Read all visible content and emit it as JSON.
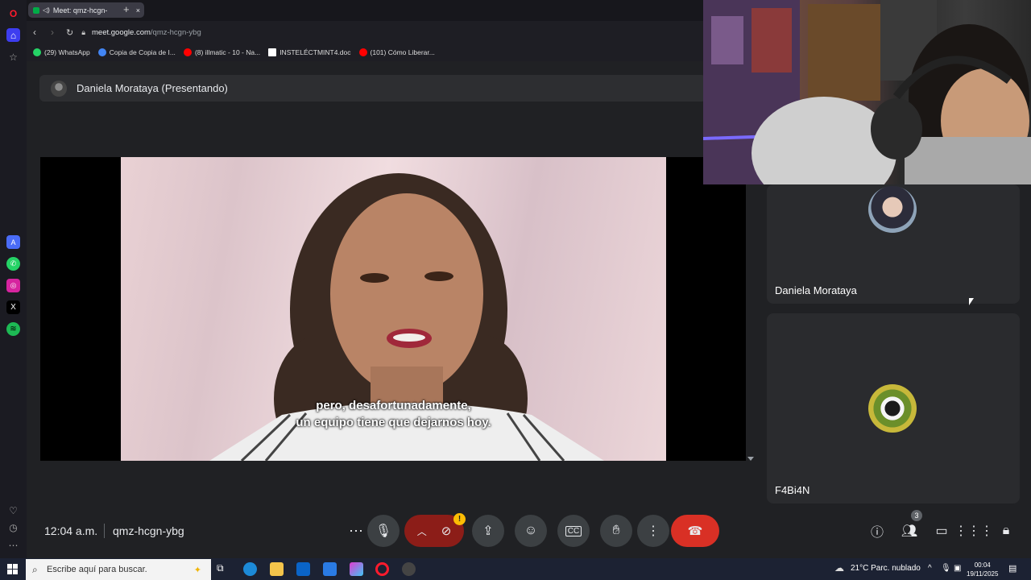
{
  "browser": {
    "tab_title": "Meet: qmz-hcgn-",
    "address": "meet.google.com/qmz-hcgn-ybg",
    "address_host": "meet.google.com",
    "address_path": "/qmz-hcgn-ybg",
    "bookmarks": [
      {
        "label": "(29) WhatsApp",
        "color": "#25d366"
      },
      {
        "label": "Copia de Copia de I...",
        "color": "#4285f4"
      },
      {
        "label": "(8) illmatic - 10 - Na...",
        "color": "#ff0000"
      },
      {
        "label": "INSTELÉCTMINT4.doc",
        "color": "#ffffff"
      },
      {
        "label": "(101) Cómo Liberar...",
        "color": "#ff0000"
      }
    ]
  },
  "meet": {
    "presenter_label": "Daniela Morataya (Presentando)",
    "subtitle_line1": "pero, desafortunadamente,",
    "subtitle_line2": "un equipo tiene que dejarnos hoy.",
    "participants": [
      {
        "name": "Daniela Morataya"
      },
      {
        "name": "F4Bi4N"
      }
    ],
    "clock": "12:04 a.m.",
    "meeting_code": "qmz-hcgn-ybg",
    "people_count": "3",
    "warning_badge": "!"
  },
  "taskbar": {
    "search_placeholder": "Escribe aquí para buscar.",
    "weather": "21°C  Parc. nublado",
    "time": "00:04",
    "date": "19/11/2025"
  },
  "colors": {
    "end_call": "#d93025",
    "camera_off": "#8c1d18",
    "warning": "#fbbc04"
  }
}
